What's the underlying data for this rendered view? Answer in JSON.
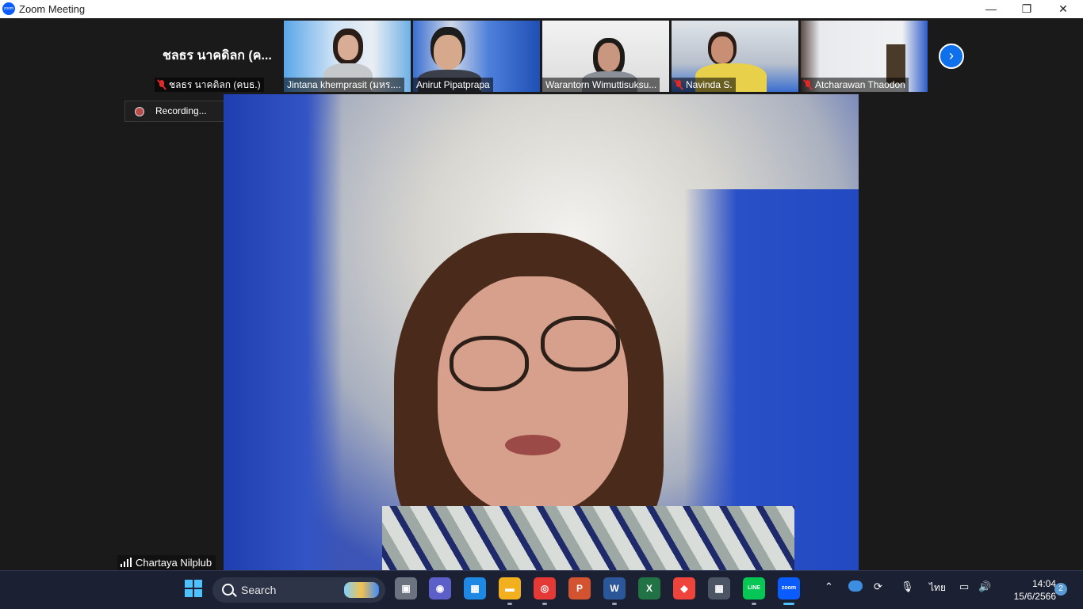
{
  "window": {
    "title": "Zoom Meeting",
    "logo_text": "zoom",
    "minimize": "—",
    "restore": "❐",
    "close": "✕"
  },
  "participants_strip": {
    "active_text_tile": {
      "display": "ชลธร นาคดิลก (ค...",
      "name": "ชลธร นาคดิลก (คบธ.)",
      "muted": true
    },
    "tiles": [
      {
        "name": "Jintana khemprasit (มหร....",
        "muted": false
      },
      {
        "name": "Anirut Pipatprapa",
        "muted": false
      },
      {
        "name": "Warantorn Wimuttisuksu...",
        "muted": false
      },
      {
        "name": "Navinda S.",
        "muted": true
      },
      {
        "name": "Atcharawan Thaodon",
        "muted": true
      }
    ],
    "next_page_arrow": "›"
  },
  "recording": {
    "label": "Recording..."
  },
  "active_speaker": {
    "name": "Chartaya Nilplub"
  },
  "taskbar": {
    "search_label": "Search",
    "tray_language": "ไทย",
    "time": "14:04",
    "date": "15/6/2566",
    "notification_count": "2",
    "apps": [
      {
        "name": "task-view",
        "color": "#6b7280",
        "glyph": "▣"
      },
      {
        "name": "teams-chat",
        "color": "#5b5fc7",
        "glyph": "◉"
      },
      {
        "name": "microsoft-store",
        "color": "#1e88e5",
        "glyph": "▦"
      },
      {
        "name": "file-explorer",
        "color": "#f2b01e",
        "glyph": "▬"
      },
      {
        "name": "chrome",
        "color": "#e53935",
        "glyph": "◎"
      },
      {
        "name": "powerpoint",
        "color": "#d35230",
        "glyph": "P"
      },
      {
        "name": "word",
        "color": "#2b579a",
        "glyph": "W"
      },
      {
        "name": "excel",
        "color": "#217346",
        "glyph": "X"
      },
      {
        "name": "anydesk",
        "color": "#ef443b",
        "glyph": "◆"
      },
      {
        "name": "calculator",
        "color": "#4b5563",
        "glyph": "▦"
      },
      {
        "name": "line",
        "color": "#06c755",
        "glyph": "LINE"
      },
      {
        "name": "zoom",
        "color": "#0b5cff",
        "glyph": "zoom"
      }
    ]
  }
}
